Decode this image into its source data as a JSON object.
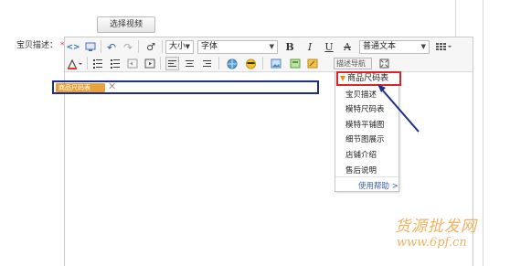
{
  "video_button": "选择视频",
  "field_label": "宝贝描述：",
  "required_mark": "*",
  "toolbar": {
    "font_size": "大小",
    "font_family": "字体",
    "bold": "B",
    "italic": "I",
    "underline": "U",
    "strike": "A",
    "paragraph_format": "普通文本",
    "describe_nav": "描述导航"
  },
  "tag": {
    "label": "商品尺码表",
    "close": "✕"
  },
  "menu": {
    "header": "商品尺码表",
    "items": [
      "宝贝描述",
      "模特尺码表",
      "模特平铺图",
      "细节图展示",
      "店铺介绍",
      "售后说明"
    ],
    "help": "使用帮助 >"
  },
  "watermark": {
    "cn": "货源批发网",
    "url": "www.6pf.cn"
  },
  "colors": {
    "highlight_blue": "#1e2e8e",
    "highlight_red": "#d8242b",
    "tag_orange": "#e7a23a",
    "watermark": "#f1b25c",
    "link_blue": "#3a62b5"
  }
}
